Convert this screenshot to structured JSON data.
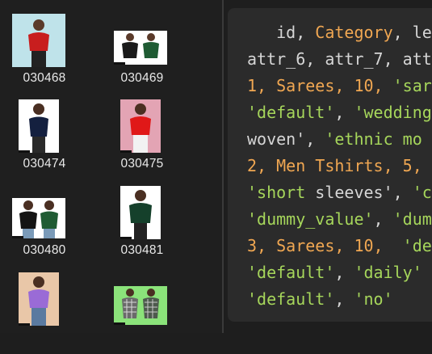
{
  "files": [
    {
      "name": "030468",
      "thumb": "red-top-model-icon"
    },
    {
      "name": "030469",
      "thumb": "black-green-tops-icon"
    },
    {
      "name": "030474",
      "thumb": "navy-top-model-icon"
    },
    {
      "name": "030475",
      "thumb": "red-top-pink-bg-icon"
    },
    {
      "name": "030480",
      "thumb": "black-green-pair-icon"
    },
    {
      "name": "030481",
      "thumb": "dark-green-top-icon"
    },
    {
      "name": "",
      "thumb": "purple-top-model-icon"
    },
    {
      "name": "",
      "thumb": "plaid-shirts-icon"
    }
  ],
  "code": {
    "lines": [
      [
        {
          "t": "   id, ",
          "c": "plain"
        },
        {
          "t": "Category",
          "c": "key"
        },
        {
          "t": ", le",
          "c": "plain"
        }
      ],
      [
        {
          "t": "attr_6, attr_7, att",
          "c": "plain"
        }
      ],
      [
        {
          "t": "1, Sarees, 10, ",
          "c": "key"
        },
        {
          "t": "'sar",
          "c": "str"
        }
      ],
      [
        {
          "t": "'default'",
          "c": "str"
        },
        {
          "t": ", ",
          "c": "plain"
        },
        {
          "t": "'wedding",
          "c": "str"
        }
      ],
      [
        {
          "t": "woven', ",
          "c": "plain"
        },
        {
          "t": "'ethnic mo",
          "c": "str"
        }
      ],
      [
        {
          "t": "2, Men Tshirts, 5, ",
          "c": "key"
        }
      ],
      [
        {
          "t": "'short ",
          "c": "str"
        },
        {
          "t": "sleeves', ",
          "c": "plain"
        },
        {
          "t": "'c",
          "c": "str"
        }
      ],
      [
        {
          "t": "'dummy_value'",
          "c": "str"
        },
        {
          "t": ", ",
          "c": "plain"
        },
        {
          "t": "'dum",
          "c": "str"
        }
      ],
      [
        {
          "t": "3, Sarees, 10,  ",
          "c": "key"
        },
        {
          "t": "'de",
          "c": "str"
        }
      ],
      [
        {
          "t": "'default'",
          "c": "str"
        },
        {
          "t": ", ",
          "c": "plain"
        },
        {
          "t": "'daily'",
          "c": "str"
        }
      ],
      [
        {
          "t": "'default'",
          "c": "str"
        },
        {
          "t": ", ",
          "c": "plain"
        },
        {
          "t": "'no'",
          "c": "str"
        }
      ]
    ]
  },
  "colors": {
    "keyword": "#f0a752",
    "string": "#a6d65b",
    "plain": "#d6d6d6"
  }
}
